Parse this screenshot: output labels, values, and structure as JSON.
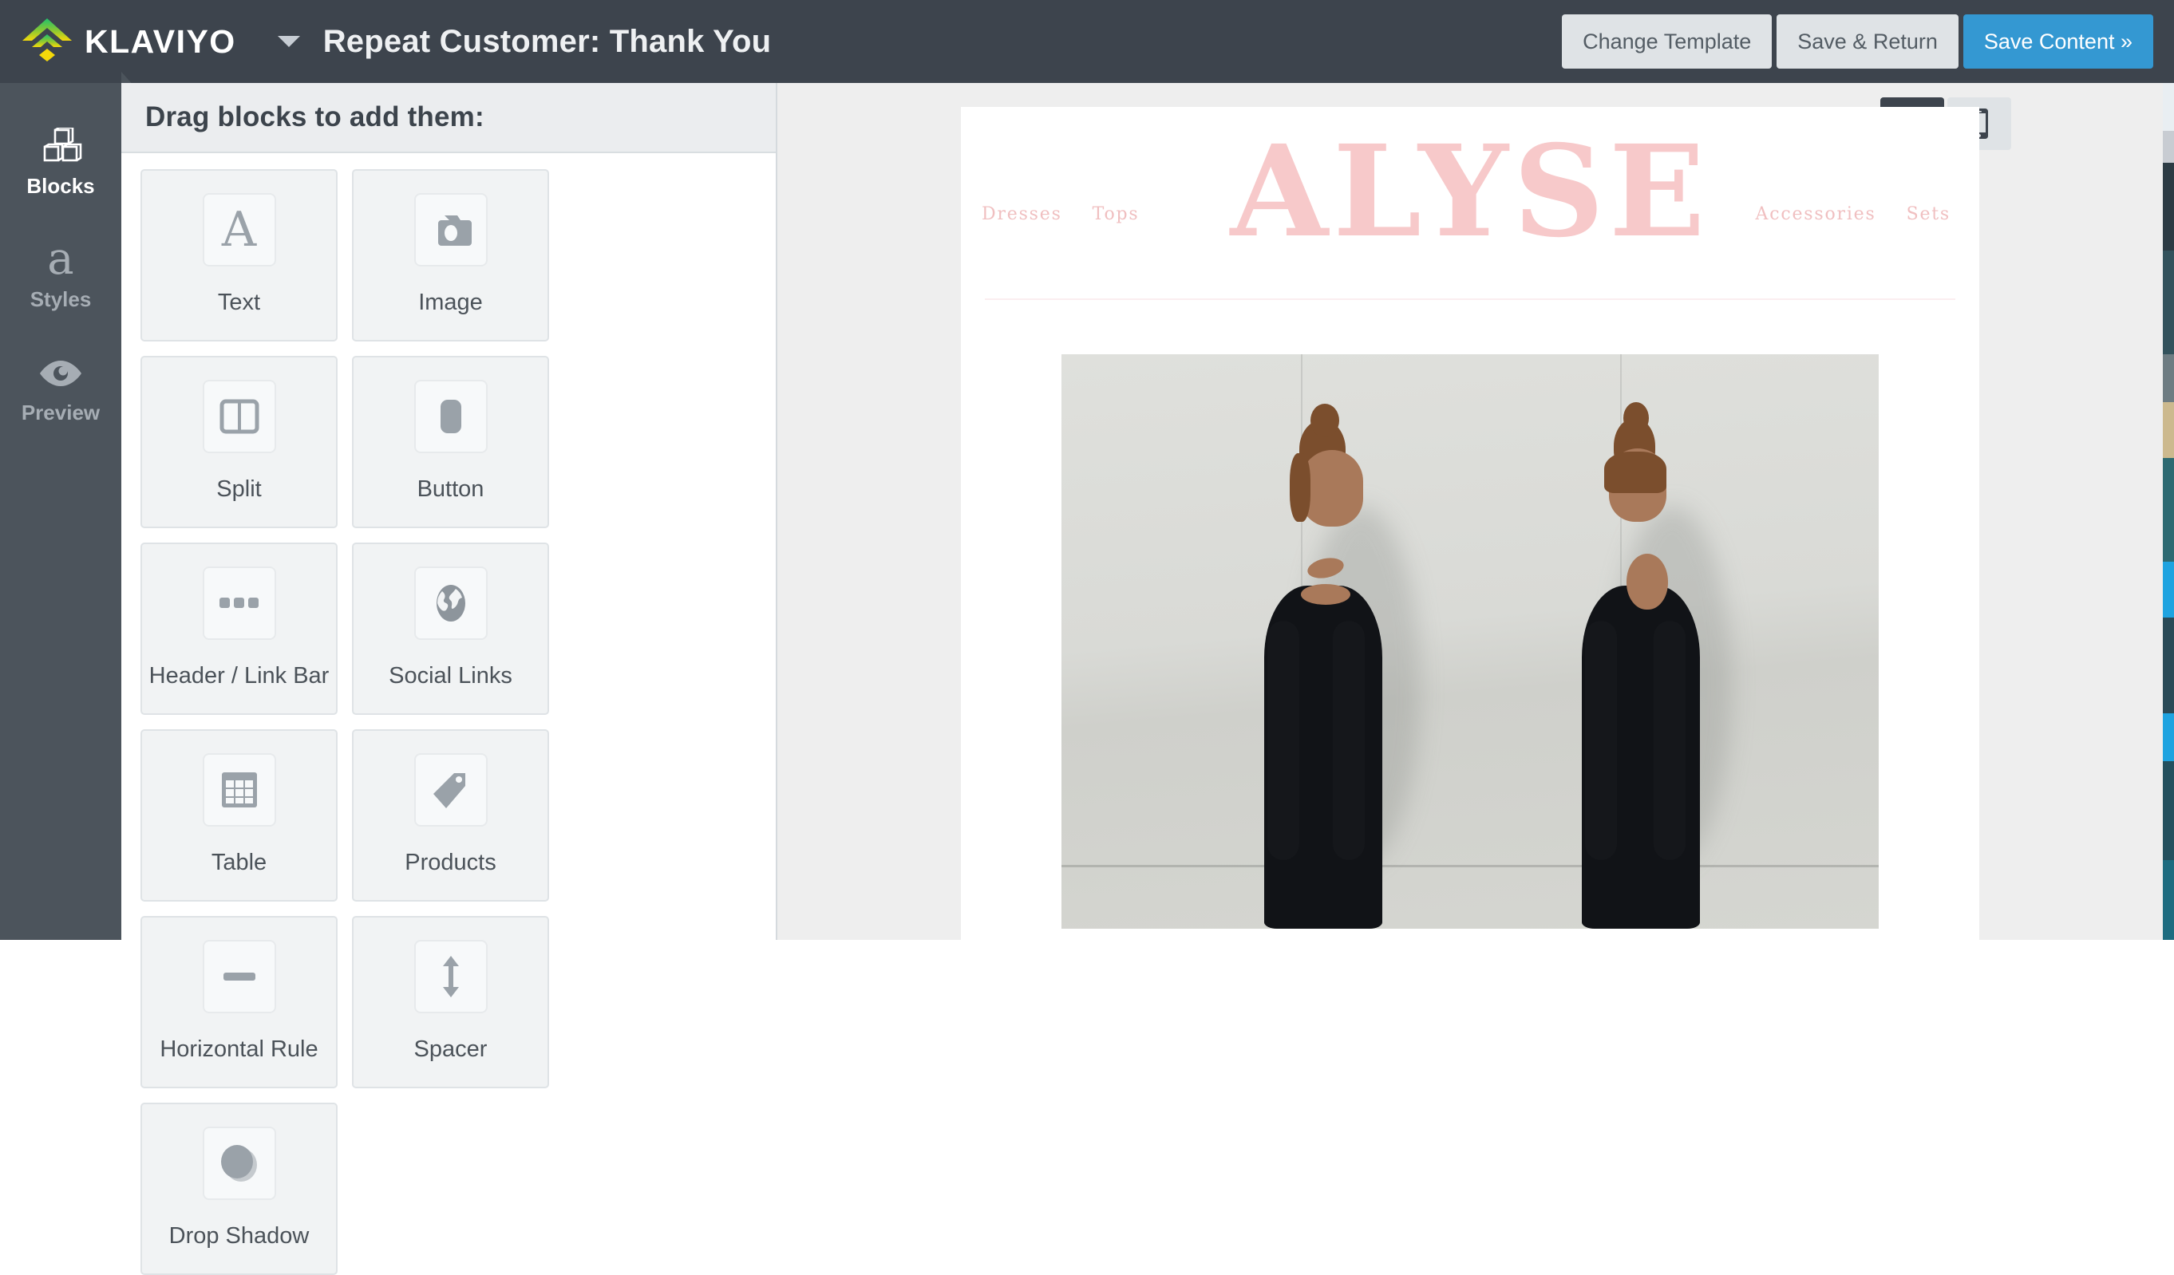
{
  "topbar": {
    "logo_word": "KLAVIYO",
    "logo_icon": "klaviyo-chevron-logo",
    "dropdown_icon": "caret-down-icon",
    "document_title": "Repeat Customer: Thank You",
    "buttons": [
      {
        "label": "Change Template",
        "style": "secondary",
        "name": "change-template-button"
      },
      {
        "label": "Save & Return",
        "style": "secondary",
        "name": "save-and-return-button"
      },
      {
        "label": "Save Content »",
        "style": "primary",
        "name": "save-content-button"
      }
    ],
    "bg_color": "#3d444d",
    "primary_color": "#3498d2"
  },
  "rail": {
    "items": [
      {
        "label": "Blocks",
        "icon": "blocks-cubes-icon",
        "active": true
      },
      {
        "label": "Styles",
        "icon": "styles-letter-a-icon",
        "active": false
      },
      {
        "label": "Preview",
        "icon": "preview-eye-icon",
        "active": false
      }
    ],
    "bg_color": "#4c545c"
  },
  "panel": {
    "header": "Drag blocks to add them:",
    "blocks": [
      {
        "label": "Text",
        "icon": "text-letter-a-icon"
      },
      {
        "label": "Image",
        "icon": "camera-icon"
      },
      {
        "label": "Split",
        "icon": "split-columns-icon"
      },
      {
        "label": "Button",
        "icon": "button-rounded-rect-icon"
      },
      {
        "label": "Header / Link Bar",
        "icon": "three-dots-icon"
      },
      {
        "label": "Social Links",
        "icon": "globe-icon"
      },
      {
        "label": "Table",
        "icon": "table-grid-icon"
      },
      {
        "label": "Products",
        "icon": "price-tag-icon"
      },
      {
        "label": "Horizontal Rule",
        "icon": "horizontal-rule-icon"
      },
      {
        "label": "Spacer",
        "icon": "vertical-double-arrow-icon"
      },
      {
        "label": "Drop Shadow",
        "icon": "drop-shadow-circle-icon"
      }
    ]
  },
  "canvas": {
    "device_toggle": [
      {
        "icon": "desktop-monitor-icon",
        "label": "Desktop",
        "active": true
      },
      {
        "icon": "mobile-phone-icon",
        "label": "Mobile",
        "active": false
      }
    ],
    "email": {
      "brand_wordmark": "ALYSE",
      "brand_color": "#f7c9ca",
      "nav_left": [
        "Dresses",
        "Tops"
      ],
      "nav_right": [
        "Accessories",
        "Sets"
      ],
      "hero_image_alt": "Two models in black long-sleeve cutout dresses against a concrete wall"
    }
  }
}
